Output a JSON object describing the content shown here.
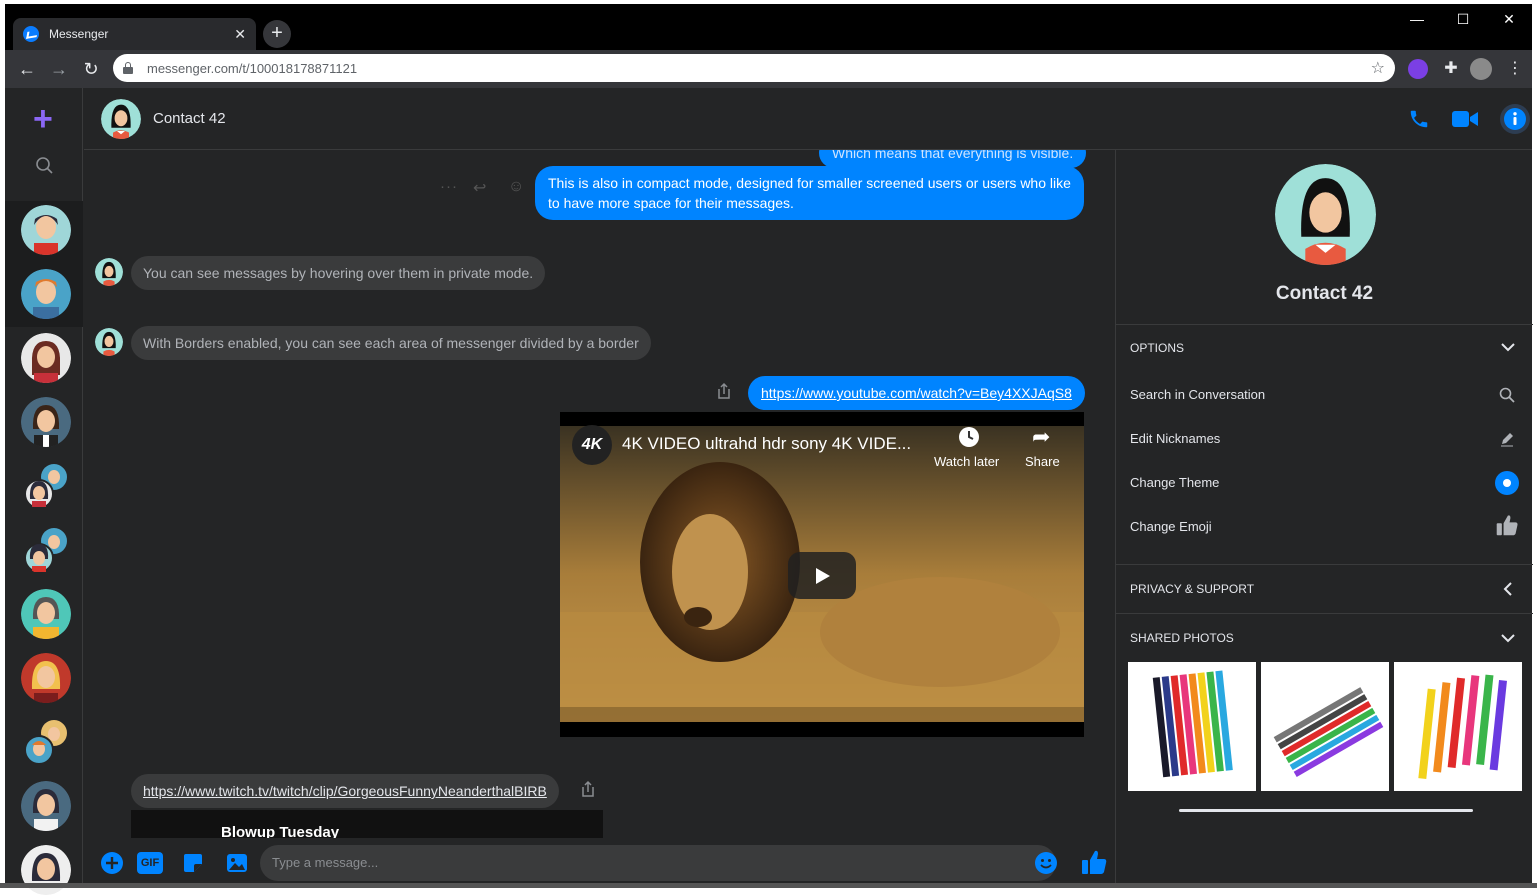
{
  "browser": {
    "tab_title": "Messenger",
    "tab_close": "✕",
    "new_tab": "+",
    "url": "messenger.com/t/100018178871121",
    "win_min": "—",
    "win_max": "☐",
    "win_close": "✕"
  },
  "header": {
    "contact_name": "Contact 42"
  },
  "messages": {
    "m0": "Which means that everything is visible.",
    "m1": "This is also in compact mode, designed for smaller screened users or users who like to have more space for their messages.",
    "m2": "You can see messages by hovering over them in private mode.",
    "m3": "With Borders enabled, you can see each area of messenger divided by a border",
    "m4_link": "https://www.youtube.com/watch?v=Bey4XXJAqS8",
    "video_title": "4K VIDEO ultrahd hdr sony 4K VIDE...",
    "video_logo": "4K",
    "watch_later": "Watch later",
    "share": "Share",
    "m5_link": "https://www.twitch.tv/twitch/clip/GorgeousFunnyNeanderthalBIRB",
    "twitch_title": "Blowup Tuesday"
  },
  "composer": {
    "placeholder": "Type a message...",
    "gif_label": "GIF"
  },
  "right_panel": {
    "name": "Contact 42",
    "options_label": "OPTIONS",
    "search_label": "Search in Conversation",
    "nicknames_label": "Edit Nicknames",
    "theme_label": "Change Theme",
    "emoji_label": "Change Emoji",
    "privacy_label": "PRIVACY & SUPPORT",
    "shared_label": "SHARED PHOTOS"
  },
  "colors": {
    "accent": "#0084ff",
    "rail_plus": "#8b67f5",
    "background": "#242526"
  }
}
